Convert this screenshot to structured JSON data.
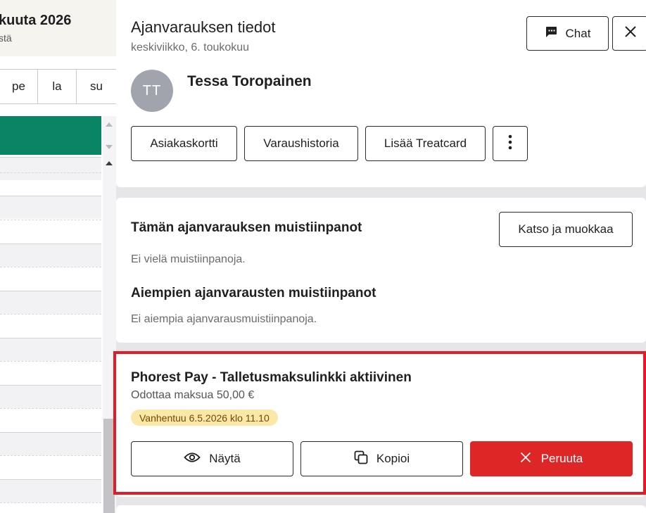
{
  "calendar": {
    "month_title": "kuuta 2026",
    "subtitle": "stä",
    "weekdays": [
      "pe",
      "la",
      "su"
    ],
    "event_color": "#098564"
  },
  "header": {
    "title": "Ajanvarauksen tiedot",
    "date": "keskiviikko, 6. toukokuu",
    "chat_label": "Chat"
  },
  "client": {
    "initials": "TT",
    "name": "Tessa Toropainen",
    "actions": {
      "card": "Asiakaskortti",
      "history": "Varaushistoria",
      "treatcard": "Lisää Treatcard"
    }
  },
  "notes": {
    "current_title": "Tämän ajanvarauksen muistiinpanot",
    "current_empty": "Ei vielä muistiinpanoja.",
    "edit_label": "Katso ja muokkaa",
    "previous_title": "Aiempien ajanvarausten muistiinpanot",
    "previous_empty": "Ei aiempia ajanvarausmuistiinpanoja."
  },
  "payment": {
    "title": "Phorest Pay - Talletusmaksulinkki aktiivinen",
    "status": "Odottaa maksua 50,00 €",
    "expiry_badge": "Vanhentuu 6.5.2026 klo 11.10",
    "view_label": "Näytä",
    "copy_label": "Kopioi",
    "cancel_label": "Peruuta",
    "highlight_color": "#e21b25",
    "cancel_color": "#de2626"
  }
}
